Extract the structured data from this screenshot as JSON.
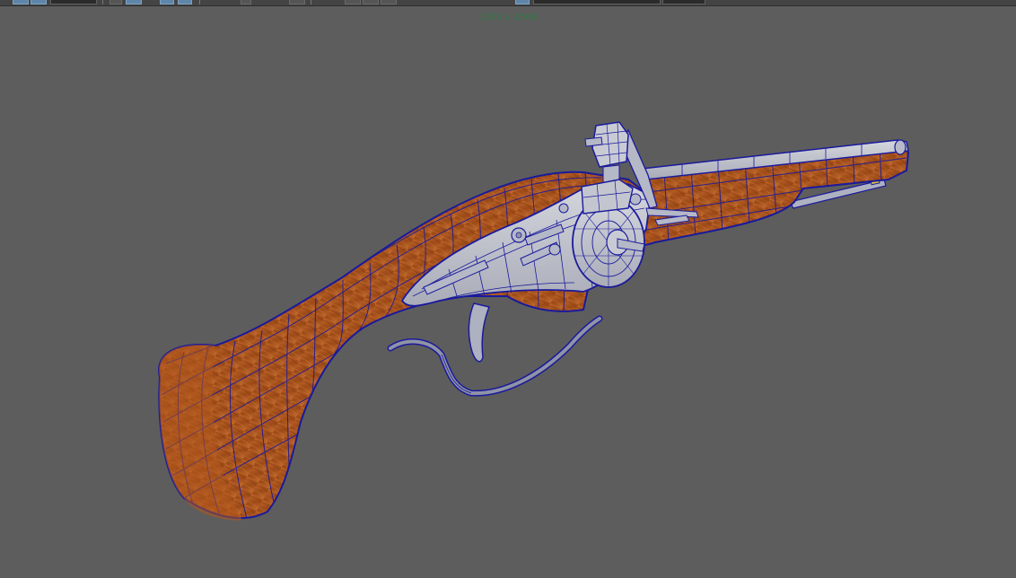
{
  "viewport": {
    "resolution_gate_label": "1500 x 1500",
    "background_color": "#5d5d5d",
    "wireframe_color": "#1a1a9c",
    "wood_color": "#a9531c",
    "metal_color": "#c4c6cf"
  },
  "toolbar": {
    "icons": [
      "select-tool-icon",
      "lasso-tool-icon",
      "camera-icon",
      "wireframe-shading-icon",
      "smooth-shading-icon",
      "isolate-select-icon",
      "xray-icon",
      "resolution-gate-icon",
      "grid-icon"
    ]
  },
  "scene": {
    "model": "wheellock-pistol",
    "display_mode": "wireframe-on-shaded"
  }
}
